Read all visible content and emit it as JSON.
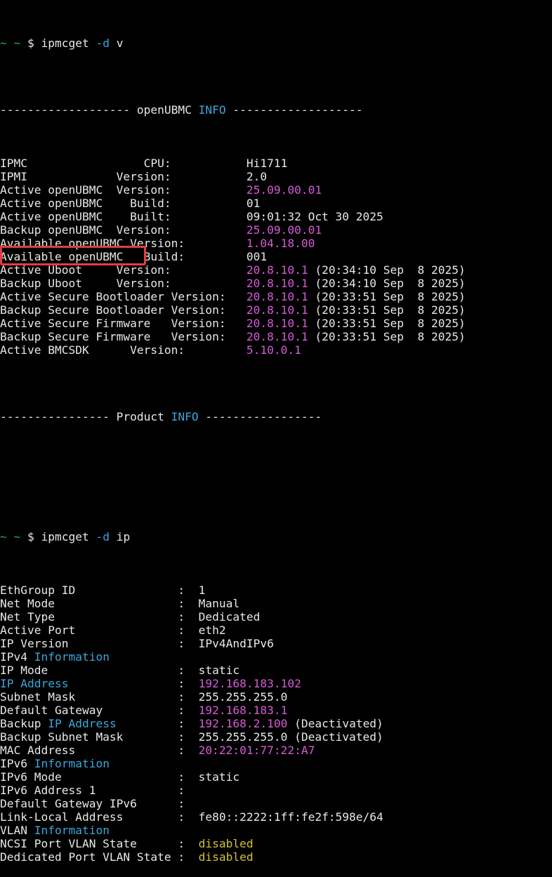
{
  "theme": {
    "background": "#000000",
    "text": "#e8e8e8",
    "prompt": "#23b14d",
    "value": "#d65bd6",
    "keyword": "#3ba6db",
    "disabled": "#d1c23a",
    "highlight_box": "#e43d3d"
  },
  "prompt": {
    "symbol": "~ ~",
    "dollar": "$"
  },
  "cmd1": {
    "name": "ipmcget",
    "flag": "-d",
    "arg": "v"
  },
  "cmd2": {
    "name": "ipmcget",
    "flag": "-d",
    "arg": "ip"
  },
  "version": {
    "header_left": "------------------- openUBMC",
    "header_kw": "INFO",
    "header_right": "-------------------",
    "rows": [
      {
        "label": "IPMC                 CPU:",
        "value": "Hi1711",
        "extra": ""
      },
      {
        "label": "IPMI             Version:",
        "value": "2.0",
        "extra": ""
      },
      {
        "label": "Active openUBMC  Version:",
        "value": "25.09.00.01",
        "extra": ""
      },
      {
        "label": "Active openUBMC    Build:",
        "value": "01",
        "extra": ""
      },
      {
        "label": "Active openUBMC    Built:",
        "value": "09:01:32 Oct 30 2025",
        "extra": ""
      },
      {
        "label": "Backup openUBMC  Version:",
        "value": "25.09.00.01",
        "extra": ""
      },
      {
        "label": "Available openUBMC Version:",
        "value": "1.04.18.00",
        "extra": ""
      },
      {
        "label": "Available openUBMC   Build:",
        "value": "001",
        "extra": ""
      },
      {
        "label": "Active Uboot     Version:",
        "value": "20.8.10.1",
        "extra": " (20:34:10 Sep  8 2025)"
      },
      {
        "label": "Backup Uboot     Version:",
        "value": "20.8.10.1",
        "extra": " (20:34:10 Sep  8 2025)"
      },
      {
        "label": "Active Secure Bootloader Version:",
        "value": "20.8.10.1",
        "extra": " (20:33:51 Sep  8 2025)"
      },
      {
        "label": "Backup Secure Bootloader Version:",
        "value": "20.8.10.1",
        "extra": " (20:33:51 Sep  8 2025)"
      },
      {
        "label": "Active Secure Firmware   Version:",
        "value": "20.8.10.1",
        "extra": " (20:33:51 Sep  8 2025)"
      },
      {
        "label": "Backup Secure Firmware   Version:",
        "value": "20.8.10.1",
        "extra": " (20:33:51 Sep  8 2025)"
      },
      {
        "label": "Active BMCSDK      Version:",
        "value": "5.10.0.1",
        "extra": ""
      }
    ],
    "footer_left": "---------------- Product",
    "footer_kw": "INFO",
    "footer_right": "-----------------"
  },
  "ip": {
    "sep": "  :  ",
    "rows": {
      "ethgroup": {
        "label": "EthGroup ID",
        "value": "1"
      },
      "netmode": {
        "label": "Net Mode",
        "value": "Manual"
      },
      "nettype": {
        "label": "Net Type",
        "value": "Dedicated"
      },
      "activeport": {
        "label": "Active Port",
        "value": "eth2"
      },
      "ipversion": {
        "label": "IP Version",
        "value": "IPv4AndIPv6"
      },
      "ipv4_section": {
        "prefix": "IPv4",
        "kw": "Information"
      },
      "ipmode": {
        "label": "IP Mode",
        "value": "static"
      },
      "ipaddress": {
        "label": "IP Address",
        "value": "192.168.183.102"
      },
      "subnet": {
        "label": "Subnet Mask",
        "value": "255.255.255.0"
      },
      "gateway": {
        "label": "Default Gateway",
        "value": "192.168.183.1"
      },
      "backupip": {
        "label_prefix": "Backup",
        "label_kw": "IP Address",
        "value": "192.168.2.100",
        "extra": "(Deactivated)"
      },
      "backupsubnet": {
        "label": "Backup Subnet Mask",
        "value": "255.255.255.0",
        "extra": "(Deactivated)"
      },
      "mac": {
        "label": "MAC Address",
        "value": "20:22:01:77:22:A7"
      },
      "ipv6_section": {
        "prefix": "IPv6",
        "kw": "Information"
      },
      "ipv6mode": {
        "label": "IPv6 Mode",
        "value": "static"
      },
      "ipv6addr": {
        "label": "IPv6 Address 1",
        "value": ""
      },
      "gwipv6": {
        "label": "Default Gateway IPv6",
        "value": ""
      },
      "linklocal": {
        "label": "Link-Local Address",
        "value": "fe80::2222:1ff:fe2f:598e/64"
      },
      "vlan_section": {
        "prefix": "VLAN",
        "kw": "Information"
      },
      "ncsivlan": {
        "label": "NCSI Port VLAN State",
        "value": "disabled"
      },
      "dedvlan": {
        "label": "Dedicated Port VLAN State",
        "value": "disabled"
      }
    }
  }
}
